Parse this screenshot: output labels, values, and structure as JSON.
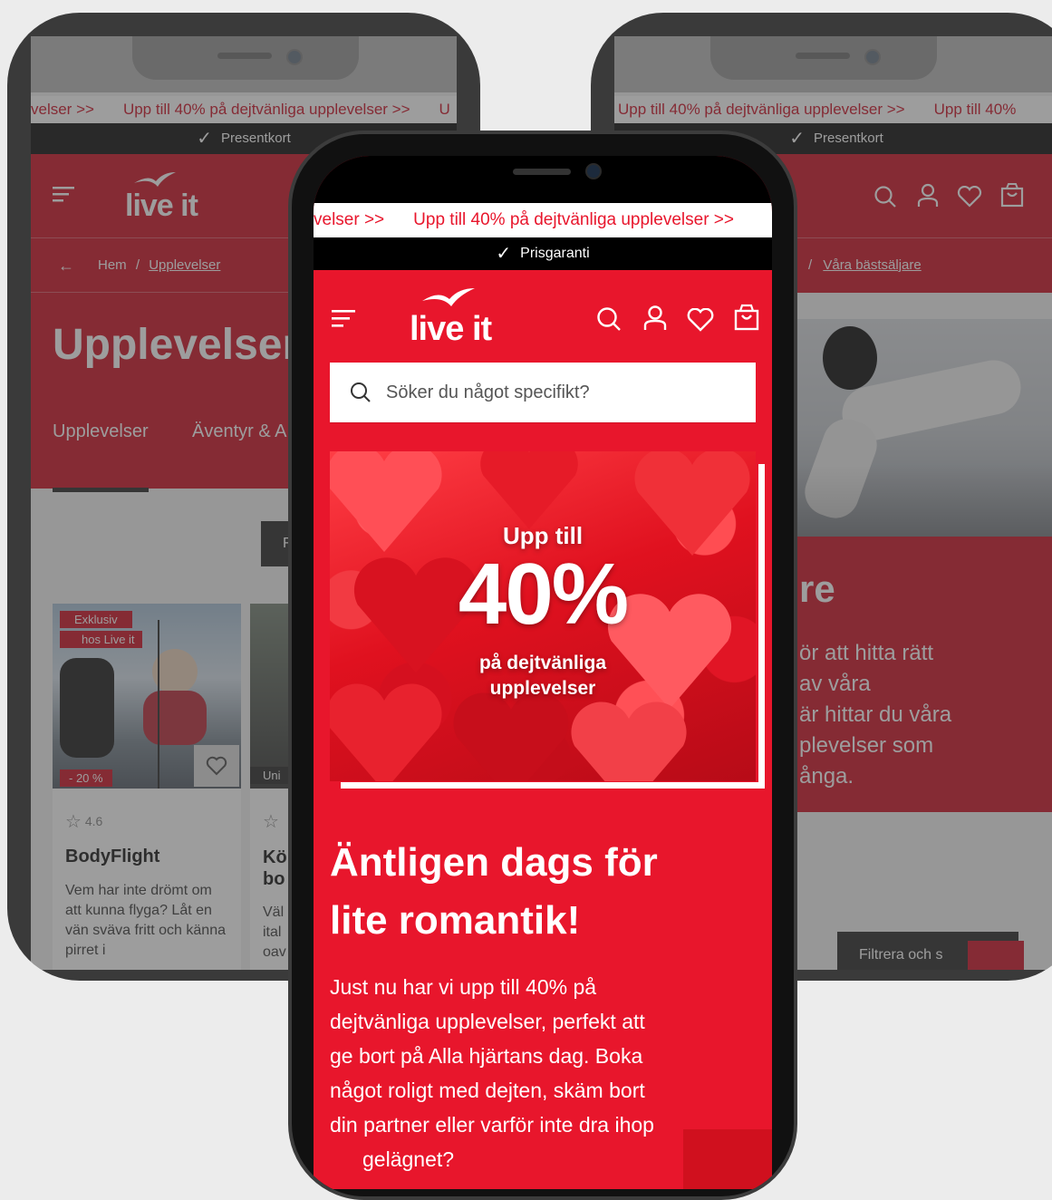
{
  "colors": {
    "brand_red": "#e8162c",
    "faded_pink": "#e98e95",
    "bg": "#ececec"
  },
  "promo_text": "Upp till 40% på dejtvänliga upplevelser >>",
  "promo_text_cut_left": "velser >>",
  "promo_text_cut_right": "Upp till 40%",
  "promo_text_cut_u": "U",
  "left_phone": {
    "guarantee": "Presentkort",
    "logo": "live it",
    "breadcrumb": {
      "home": "Hem",
      "separator": "/",
      "current": "Upplevelser"
    },
    "page_title": "Upplevelser",
    "categories": [
      "Upplevelser",
      "Äventyr & A"
    ],
    "filter_label": "F",
    "product": {
      "badge_line1": "Exklusiv",
      "badge_line2": "hos Live it",
      "discount": "- 20 %",
      "rating": "4.6",
      "title": "BodyFlight",
      "description": "Vem har inte drömt om att kunna flyga? Låt en vän sväva fritt och känna pirret i"
    },
    "product2": {
      "tag": "Uni",
      "title": "Kö bo",
      "desc1": "Väl",
      "desc2": "ital",
      "desc3": "oav"
    }
  },
  "right_phone": {
    "guarantee": "Presentkort",
    "breadcrumb": {
      "separator": "/",
      "current": "Våra bästsäljare"
    },
    "heading_fragment": "re",
    "body_lines": [
      "ör att hitta rätt",
      "av våra",
      "är hittar du våra",
      "plevelser som",
      "ånga."
    ],
    "filter_label": "Filtrera och s"
  },
  "center_phone": {
    "guarantee": "Prisgaranti",
    "logo": "live it",
    "search_placeholder": "Söker du något specifikt?",
    "hero": {
      "top": "Upp till",
      "big": "40%",
      "line1": "på dejtvänliga",
      "line2": "upplevelser"
    },
    "headline_line1": "Äntligen dags för",
    "headline_line2": "lite romantik!",
    "body_lines": [
      "Just nu har vi upp till 40% på",
      "dejtvänliga upplevelser, perfekt att",
      "ge bort på Alla hjärtans dag. Boka",
      "något roligt med dejten, skäm bort",
      "din partner eller varför inte dra ihop",
      "gelägnet?"
    ]
  },
  "icons": [
    "menu-icon",
    "search-icon",
    "account-icon",
    "heart-icon",
    "bag-icon",
    "arrow-left-icon",
    "star-icon",
    "check-icon"
  ]
}
